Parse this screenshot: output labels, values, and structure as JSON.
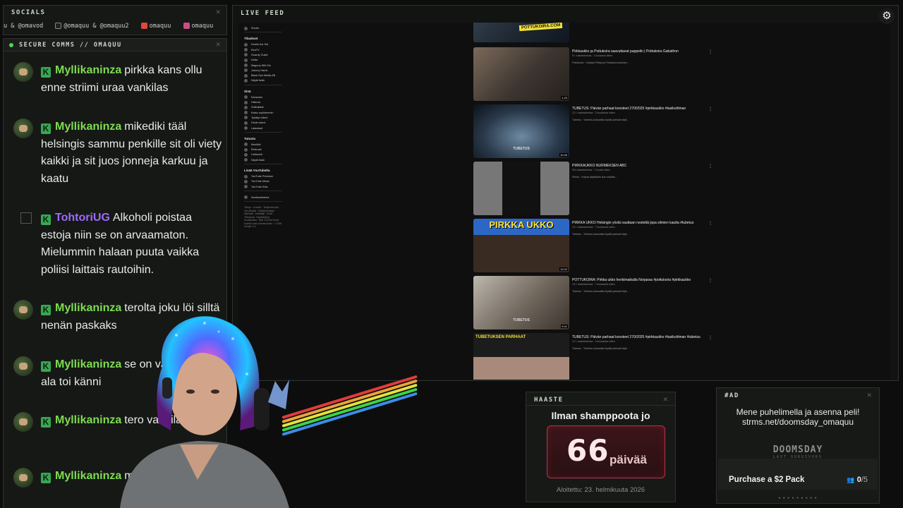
{
  "socials": {
    "title": "SOCIALS",
    "handles": [
      "u & @omavod",
      "@omaquu & @omaquu2",
      "omaquu",
      "omaquu"
    ],
    "colors": [
      "#6a6a6a",
      "#d4d4d4",
      "#e0483e",
      "#c94e86"
    ]
  },
  "chat": {
    "title": "SECURE COMMS // OMAQUU",
    "messages": [
      {
        "user": "Myllikaninza",
        "text": "pirkka kans ollu enne striimi uraa vankilas",
        "color": "green",
        "avatar": "avatar"
      },
      {
        "user": "Myllikaninza",
        "text": "mikediki tääl helsingis sammu penkille sit oli viety kaikki ja sit juos jonneja karkuu ja kaatu",
        "color": "green",
        "avatar": "avatar"
      },
      {
        "user": "TohtoriUG",
        "text": "Alkoholi poistaa estoja niin se on arvaamaton. Mielummin halaan puuta vaikka poliisi laittais rautoihin.",
        "color": "purple",
        "avatar": "broken"
      },
      {
        "user": "Myllikaninza",
        "text": "terolta joku löi silltä nenän paskaks",
        "color": "green",
        "avatar": "avatar"
      },
      {
        "user": "Myllikaninza",
        "text": "se on vaarallinen ala toi känni",
        "color": "green",
        "avatar": "avatar"
      },
      {
        "user": "Myllikaninza",
        "text": "tero vankilaan",
        "color": "green",
        "avatar": "avatar"
      },
      {
        "user": "Myllikaninza",
        "text": "mt ongelmat",
        "color": "green",
        "avatar": "avatar"
      }
    ]
  },
  "livefeed": {
    "title": "LIVE FEED",
    "sidebar": {
      "top": [
        {
          "label": "Shorts"
        }
      ],
      "subs_title": "Tilaukset",
      "subs": [
        "Karetn the Kid",
        "KiraTV",
        "Guardy Guide",
        "Notta",
        "Magnus 666 Gin",
        "Johnny Harris",
        "Black Eye Media AB",
        "Näytä lisää"
      ],
      "you_title": "Sinä",
      "you": [
        "Kanavasi",
        "Historia",
        "Soittolistat",
        "Katso myöhemmin",
        "Tykätyt videot",
        "Omat videot",
        "Lataukset"
      ],
      "explore_title": "Tutustu",
      "explore": [
        "Musiikki",
        "Elokuvat",
        "Uutisointi",
        "Näytä lisää"
      ],
      "more_title": "Lisää YouTubelta",
      "more": [
        "YouTube Premium",
        "YouTube Music",
        "YouTube Kids"
      ],
      "settings": "Ilmoitushistoria",
      "footer": "Tietoja · Lehdistö · Tekijänoikeudet · Ota yhteyttä · Sisällöntuottajat · Mainosta · Kehittäjät · Ehdot · Tietosuoja · Käytäntöjä ja turvallisuutta · Näin YouTube toimii · Kokeile uusia ominaisuuksia · © 2026 Google LLC"
    },
    "videos": [
      {
        "title": "",
        "meta": "",
        "desc": "",
        "duration": "",
        "overlay": "POTTUKOIRA.COM"
      },
      {
        "title": "Pirkkaukko ja Pottukoira saavuttavat puppelin | Pottukoira Gabathon",
        "meta": "5 t. katselukertaa · 1 kuukausi sitten",
        "desc": "Pottukoira · Hokkaa Pirkka ja Pottukoira kokeilee...",
        "duration": "1:23",
        "overlay": ""
      },
      {
        "title": "TUBETUS: Päivän parhaat koosteet 270/2025 #pirkkaukko #tasikuhlman",
        "meta": "12 t. katselukertaa · 3 kuukautta sitten",
        "desc": "Tubetus · Tubetus-kanavalta löydät parhaat klipit...",
        "duration": "10:40",
        "overlay": "TUBETUS"
      },
      {
        "title": "PIRKKAUKKO NURMEKSEN ABC",
        "meta": "991 katselukertaa · 2 vuotta sitten",
        "desc": "Pirkka · Kelpaa äijääkään kuin mikään...",
        "duration": "",
        "overlay": ""
      },
      {
        "title": "PIRKKA UKKO Helsingin yöstä nauttaan nestettä jopa silmien kautta #tubetus",
        "meta": "13 t. katselukertaa · 7 kuukautta sitten",
        "desc": "Tubetus · Tubetus-kanavalta löydät parhaat klipit...",
        "duration": "12:02",
        "overlay": "PIRKKA UKKO"
      },
      {
        "title": "POTTUKOIRA: Pirkka ukko henkimaikalla Norjassa #pottukoira #pirkkaukko",
        "meta": "13 t. katselukertaa · 7 kuukautta sitten",
        "desc": "Tubetus · Tubetus-kanavalta löydät parhaat klipit...",
        "duration": "9:41",
        "overlay": "TUBETUS"
      },
      {
        "title": "TUBETUS: Päivän parhaat koosteet 270/2025 #pirkkaukko #tasikuhlman #tubetus",
        "meta": "12 t. katselukertaa · 3 kuukautta sitten",
        "desc": "Tubetus · Tubetus-kanavalta löydät parhaat klipit...",
        "duration": "",
        "overlay": "TUBETUKSEN PARHAAT"
      }
    ]
  },
  "haaste": {
    "title": "HAASTE",
    "label": "Ilman shamppoota jo",
    "days": "66",
    "unit": "päivää",
    "started": "Aloitettu: 23. helmikuuta 2026"
  },
  "ad": {
    "title": "#AD",
    "line1": "Mene puhelimella ja asenna peli!",
    "line2": "strms.net/doomsday_omaquu",
    "logo": "DOOMSDAY",
    "sublogo": "LAST SURVIVORS",
    "purchase": "Purchase a $2 Pack",
    "count": "0",
    "total": "/5"
  },
  "icons": {
    "settings": "gear-icon"
  }
}
